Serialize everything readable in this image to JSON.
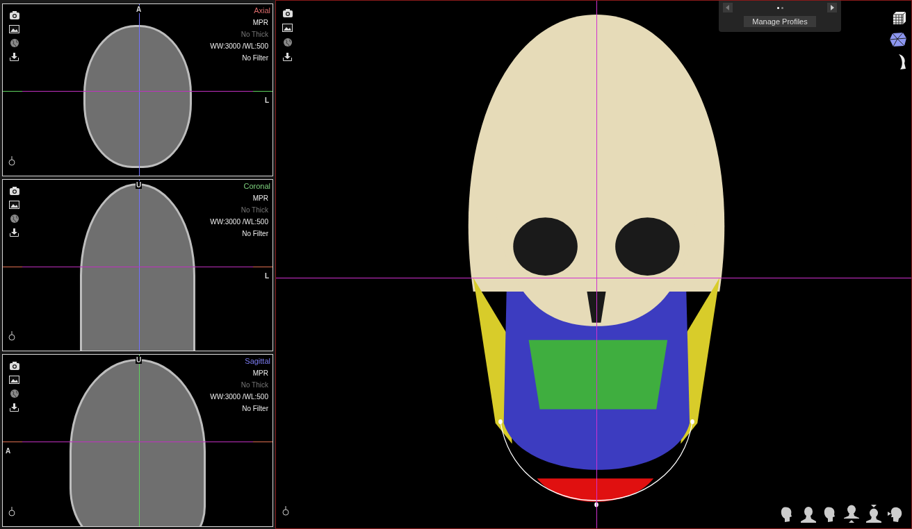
{
  "views": [
    {
      "name": "Axial",
      "color": "#d96a6a",
      "top_label": "A",
      "side_label": "L",
      "info": [
        {
          "text": "MPR",
          "disabled": false
        },
        {
          "text": "No Thick",
          "disabled": true
        },
        {
          "text": "WW:3000 /WL:500",
          "disabled": false
        },
        {
          "text": "No Filter",
          "disabled": false
        }
      ]
    },
    {
      "name": "Coronal",
      "color": "#7fd37f",
      "top_label": "U",
      "side_label": "L",
      "info": [
        {
          "text": "MPR",
          "disabled": false
        },
        {
          "text": "No Thick",
          "disabled": true
        },
        {
          "text": "WW:3000 /WL:500",
          "disabled": false
        },
        {
          "text": "No Filter",
          "disabled": false
        }
      ]
    },
    {
      "name": "Sagittal",
      "color": "#7b7bf0",
      "top_label": "U",
      "side_label": "A",
      "info": [
        {
          "text": "MPR",
          "disabled": false
        },
        {
          "text": "No Thick",
          "disabled": true
        },
        {
          "text": "WW:3000 /WL:500",
          "disabled": false
        },
        {
          "text": "No Filter",
          "disabled": false
        }
      ]
    }
  ],
  "profiles": {
    "pages": [
      {
        "selected": true
      },
      {
        "selected": false
      }
    ],
    "button": "Manage Profiles"
  }
}
